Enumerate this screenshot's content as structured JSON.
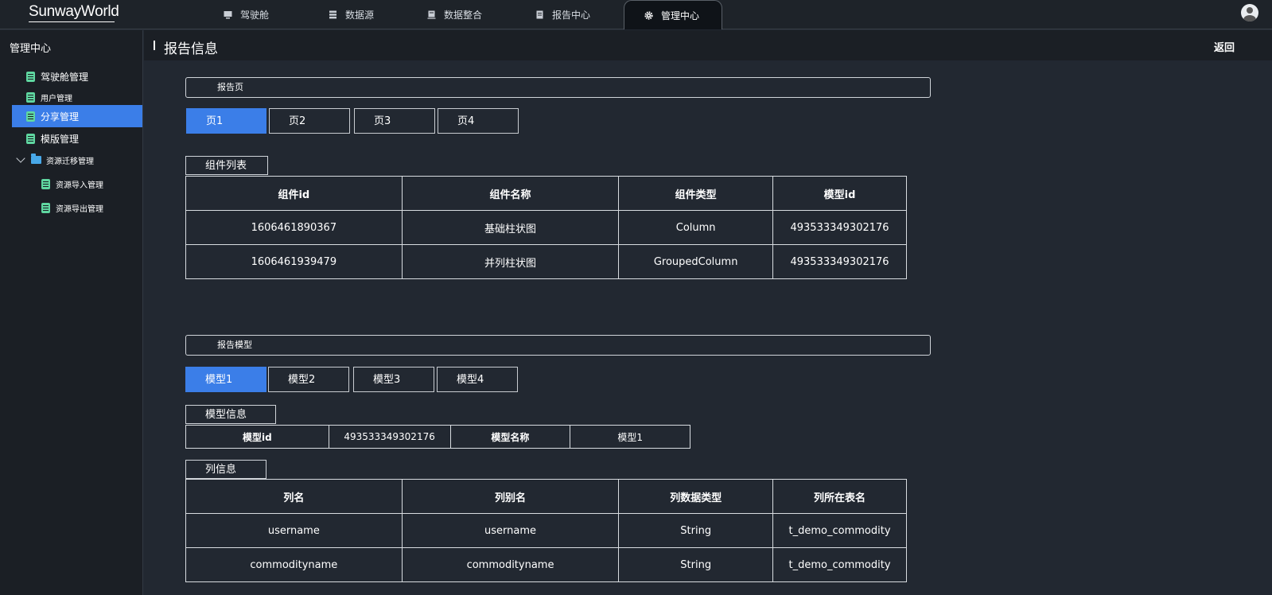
{
  "app": {
    "logo": "SunwayWorld"
  },
  "topnav": {
    "tabs": [
      {
        "label": "驾驶舱",
        "icon": "monitor-icon"
      },
      {
        "label": "数据源",
        "icon": "database-icon"
      },
      {
        "label": "数据整合",
        "icon": "server-icon"
      },
      {
        "label": "报告中心",
        "icon": "report-icon"
      },
      {
        "label": "管理中心",
        "icon": "gear-icon",
        "active": true
      }
    ]
  },
  "sidebar": {
    "title": "管理中心",
    "items": [
      {
        "label": "驾驶舱管理",
        "icon": "doc-icon"
      },
      {
        "label": "用户管理",
        "icon": "doc-icon"
      },
      {
        "label": "分享管理",
        "icon": "doc-icon",
        "active": true
      },
      {
        "label": "模版管理",
        "icon": "doc-icon"
      },
      {
        "label": "资源迁移管理",
        "icon": "folder-icon",
        "expanded": true
      },
      {
        "label": "资源导入管理",
        "icon": "doc-icon"
      },
      {
        "label": "资源导出管理",
        "icon": "doc-icon"
      }
    ]
  },
  "header": {
    "title": "报告信息",
    "back": "返回"
  },
  "report_pages": {
    "section_title": "报告页",
    "tabs": [
      "页1",
      "页2",
      "页3",
      "页4"
    ],
    "active": 0
  },
  "components": {
    "label": "组件列表",
    "columns": [
      "组件id",
      "组件名称",
      "组件类型",
      "模型id"
    ],
    "rows": [
      [
        "1606461890367",
        "基础柱状图",
        "Column",
        "493533349302176"
      ],
      [
        "1606461939479",
        "并列柱状图",
        "GroupedColumn",
        "493533349302176"
      ]
    ]
  },
  "report_models": {
    "section_title": "报告模型",
    "tabs": [
      "模型1",
      "模型2",
      "模型3",
      "模型4"
    ],
    "active": 0
  },
  "model_info": {
    "label": "模型信息",
    "cells": [
      "模型id",
      "493533349302176",
      "模型名称",
      "模型1"
    ]
  },
  "column_info": {
    "label": "列信息",
    "columns": [
      "列名",
      "列别名",
      "列数据类型",
      "列所在表名"
    ],
    "rows": [
      [
        "username",
        "username",
        "String",
        "t_demo_commodity"
      ],
      [
        "commodityname",
        "commodityname",
        "String",
        "t_demo_commodity"
      ]
    ]
  }
}
